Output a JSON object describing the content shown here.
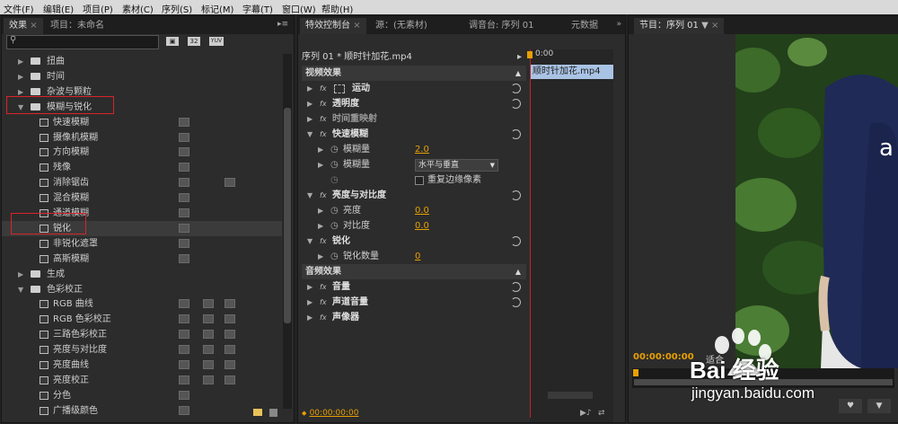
{
  "menu": [
    "文件(F)",
    "编辑(E)",
    "项目(P)",
    "素材(C)",
    "序列(S)",
    "标记(M)",
    "字幕(T)",
    "窗口(W)",
    "帮助(H)"
  ],
  "effects_panel": {
    "tabs": [
      "效果",
      "项目：未命名"
    ],
    "badge_labels": [
      "32",
      "YUV"
    ],
    "tree": [
      {
        "type": "folder",
        "label": "扭曲",
        "expanded": false
      },
      {
        "type": "folder",
        "label": "时间",
        "expanded": false
      },
      {
        "type": "folder",
        "label": "杂波与颗粒",
        "expanded": false
      },
      {
        "type": "folder",
        "label": "模糊与锐化",
        "expanded": true
      },
      {
        "type": "effect",
        "label": "快速模糊"
      },
      {
        "type": "effect",
        "label": "摄像机模糊"
      },
      {
        "type": "effect",
        "label": "方向模糊"
      },
      {
        "type": "effect",
        "label": "残像"
      },
      {
        "type": "effect",
        "label": "消除锯齿"
      },
      {
        "type": "effect",
        "label": "混合模糊"
      },
      {
        "type": "effect",
        "label": "通道模糊"
      },
      {
        "type": "effect",
        "label": "锐化",
        "selected": true
      },
      {
        "type": "effect",
        "label": "非锐化遮罩"
      },
      {
        "type": "effect",
        "label": "高斯模糊"
      },
      {
        "type": "folder",
        "label": "生成",
        "expanded": false
      },
      {
        "type": "folder",
        "label": "色彩校正",
        "expanded": true
      },
      {
        "type": "effect",
        "label": "RGB 曲线"
      },
      {
        "type": "effect",
        "label": "RGB 色彩校正"
      },
      {
        "type": "effect",
        "label": "三路色彩校正"
      },
      {
        "type": "effect",
        "label": "亮度与对比度"
      },
      {
        "type": "effect",
        "label": "亮度曲线"
      },
      {
        "type": "effect",
        "label": "亮度校正"
      },
      {
        "type": "effect",
        "label": "分色"
      },
      {
        "type": "effect",
        "label": "广播级颜色"
      }
    ]
  },
  "effect_controls": {
    "tabs": [
      "特效控制台",
      "源：(无素材)",
      "调音台: 序列 01",
      "元数据"
    ],
    "header": "序列 01 * 顺时针加花.mp4",
    "timeline_time": "0:00",
    "clip_name": "顺时针加花.mp4",
    "video_section": "视频效果",
    "audio_section": "音频效果",
    "timecode": "00:00:00:00",
    "rows": [
      {
        "kind": "effect",
        "label": "运动",
        "fx": true
      },
      {
        "kind": "effect",
        "label": "透明度",
        "fx": true
      },
      {
        "kind": "effect",
        "label": "时间重映射",
        "fx": true,
        "dim": true
      },
      {
        "kind": "effect",
        "label": "快速模糊",
        "fx": true,
        "open": true
      },
      {
        "kind": "param",
        "label": "模糊量",
        "value": "2.0"
      },
      {
        "kind": "param",
        "label": "模糊量",
        "select": "水平与垂直"
      },
      {
        "kind": "check",
        "label": "重复边缘像素"
      },
      {
        "kind": "effect",
        "label": "亮度与对比度",
        "fx": true,
        "open": true
      },
      {
        "kind": "param",
        "label": "亮度",
        "value": "0.0"
      },
      {
        "kind": "param",
        "label": "对比度",
        "value": "0.0"
      },
      {
        "kind": "effect",
        "label": "锐化",
        "fx": true,
        "open": true
      },
      {
        "kind": "param",
        "label": "锐化数量",
        "value": "0"
      }
    ],
    "audio_rows": [
      "音量",
      "声道音量",
      "声像器"
    ]
  },
  "program_monitor": {
    "tab": "节目：序列 01",
    "timecode": "00:00:00:00",
    "fit_label": "适合"
  },
  "watermark": {
    "brand": "Bai 经验",
    "url": "jingyan.baidu.com"
  },
  "colors": {
    "accent": "#e8a000",
    "highlight_box": "#d8232a",
    "playhead": "#c0242b"
  }
}
